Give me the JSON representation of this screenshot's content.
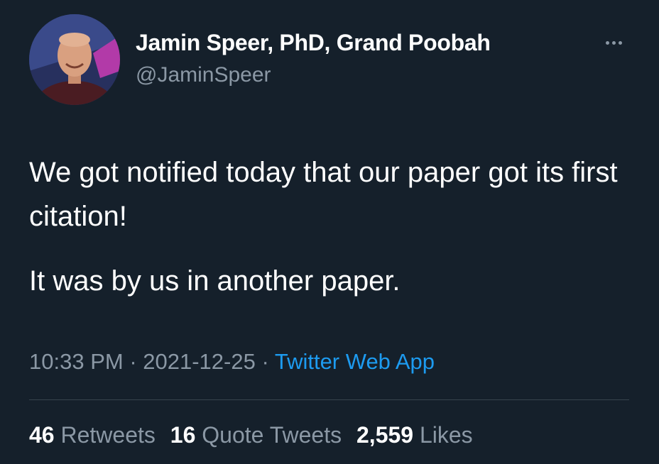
{
  "author": {
    "display_name": "Jamin Speer, PhD, Grand Poobah",
    "handle": "@JaminSpeer"
  },
  "tweet": {
    "line1": "We got notified today that our paper got its first citation!",
    "line2": "It was by us in another paper."
  },
  "meta": {
    "time": "10:33 PM",
    "separator": " · ",
    "date": "2021-12-25",
    "source": "Twitter Web App"
  },
  "stats": {
    "retweets_count": "46",
    "retweets_label": "Retweets",
    "quotes_count": "16",
    "quotes_label": "Quote Tweets",
    "likes_count": "2,559",
    "likes_label": "Likes"
  },
  "icons": {
    "more": "more-horizontal-icon",
    "avatar": "profile-photo"
  },
  "colors": {
    "background": "#15202b",
    "text": "#ffffff",
    "secondary": "#8b98a5",
    "link": "#1d9bf0",
    "divider": "#38444d"
  }
}
